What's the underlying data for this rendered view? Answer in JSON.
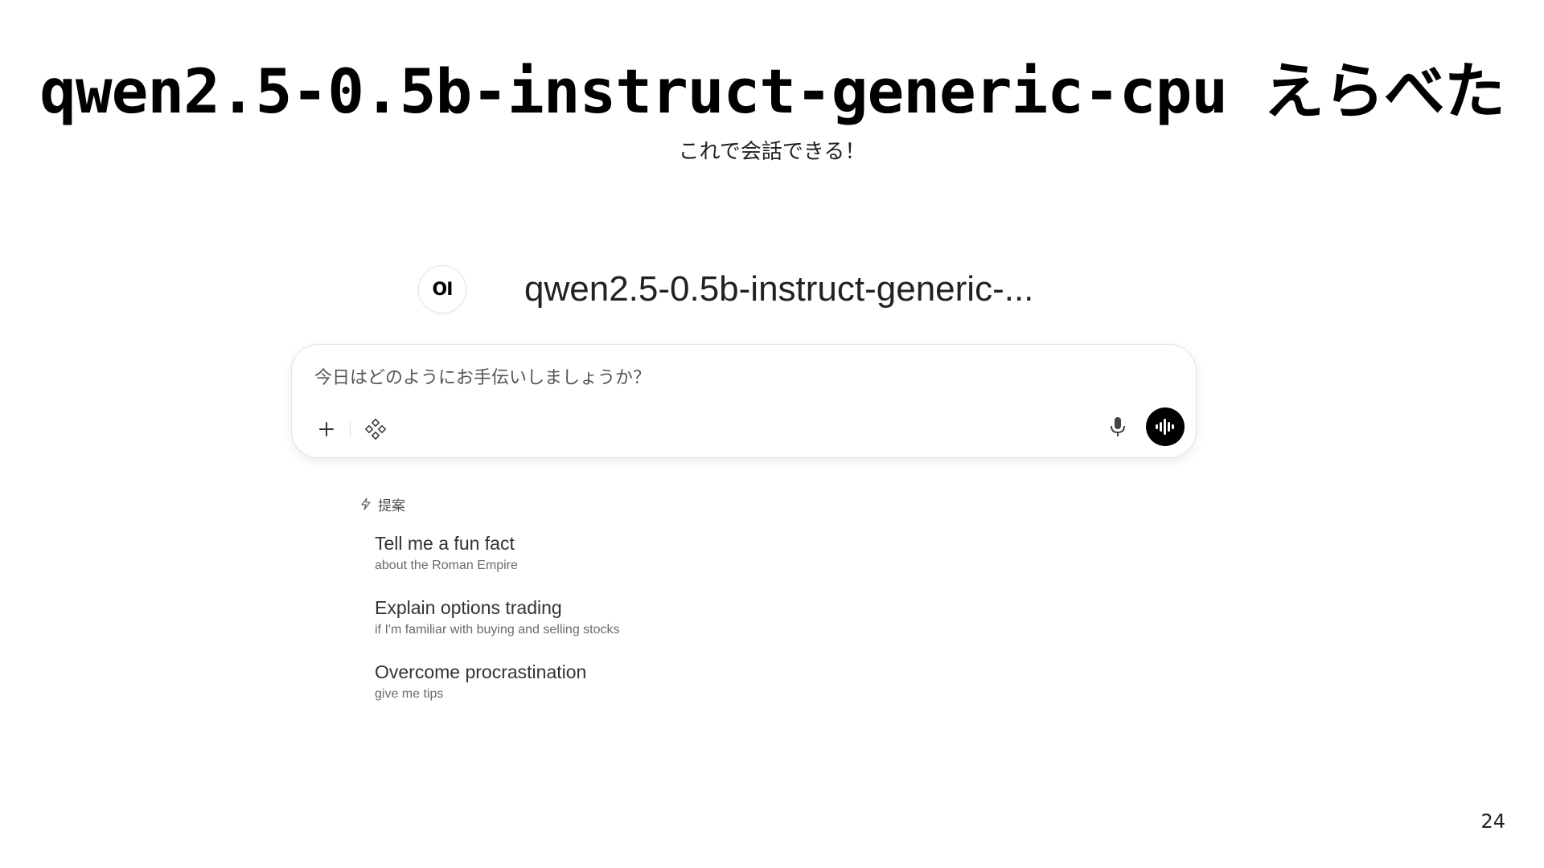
{
  "slide": {
    "title": "qwen2.5-0.5b-instruct-generic-cpu えらべた",
    "subtitle": "これで会話できる！",
    "page_number": "24"
  },
  "chat_ui": {
    "logo_text": "OI",
    "model_name": "qwen2.5-0.5b-instruct-generic-...",
    "input_placeholder": "今日はどのようにお手伝いしましょうか？",
    "icons": {
      "add": "plus-icon",
      "tools": "integrations-icon",
      "mic": "microphone-icon",
      "voice": "voice-mode-icon",
      "suggestions": "bolt-icon"
    },
    "suggestions_label": "提案",
    "suggestions": [
      {
        "title": "Tell me a fun fact",
        "subtitle": "about the Roman Empire"
      },
      {
        "title": "Explain options trading",
        "subtitle": "if I'm familiar with buying and selling stocks"
      },
      {
        "title": "Overcome procrastination",
        "subtitle": "give me tips"
      }
    ]
  },
  "colors": {
    "background": "#ffffff",
    "voice_button": "#000000",
    "border": "#e3e3e3"
  }
}
